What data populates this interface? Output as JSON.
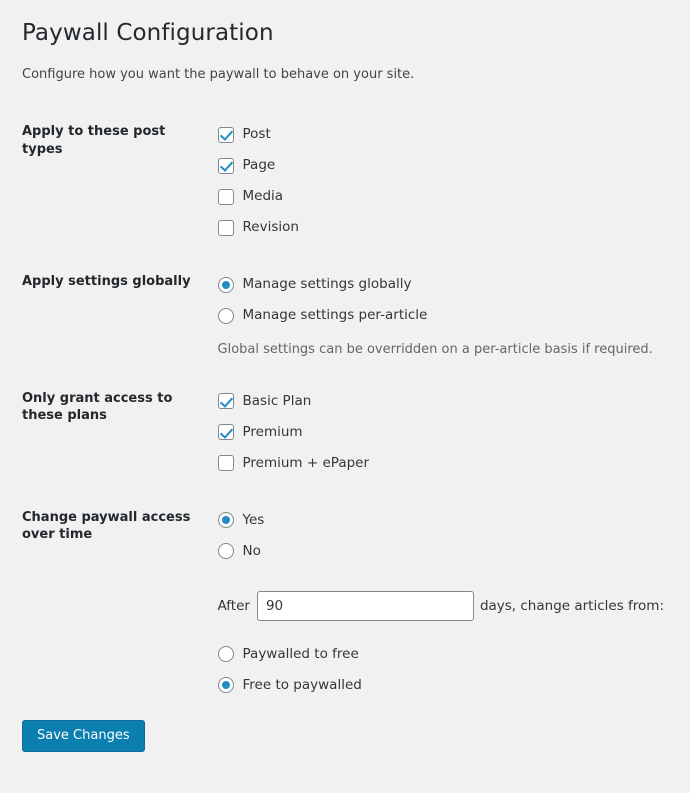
{
  "page": {
    "title": "Paywall Configuration",
    "subtitle": "Configure how you want the paywall to behave on your site."
  },
  "colors": {
    "background": "#f1f1f1",
    "accent": "#1f8dc4",
    "button": "#0b7fb0",
    "text": "#32373c",
    "muted": "#666666"
  },
  "sections": {
    "post_types": {
      "label": "Apply to these post types",
      "options": [
        {
          "label": "Post",
          "checked": true
        },
        {
          "label": "Page",
          "checked": true
        },
        {
          "label": "Media",
          "checked": false
        },
        {
          "label": "Revision",
          "checked": false
        }
      ]
    },
    "global_settings": {
      "label": "Apply settings globally",
      "options": [
        {
          "label": "Manage settings globally",
          "checked": true
        },
        {
          "label": "Manage settings per-article",
          "checked": false
        }
      ],
      "helper": "Global settings can be overridden on a per-article basis if required."
    },
    "plans": {
      "label": "Only grant access to these plans",
      "options": [
        {
          "label": "Basic Plan",
          "checked": true
        },
        {
          "label": "Premium",
          "checked": true
        },
        {
          "label": "Premium + ePaper",
          "checked": false
        }
      ]
    },
    "access_over_time": {
      "label": "Change paywall access over time",
      "options": [
        {
          "label": "Yes",
          "checked": true
        },
        {
          "label": "No",
          "checked": false
        }
      ],
      "duration": {
        "prefix": "After",
        "value": "90",
        "placeholder": "",
        "suffix": "days, change articles from:"
      },
      "direction_options": [
        {
          "label": "Paywalled to free",
          "checked": false
        },
        {
          "label": "Free to paywalled",
          "checked": true
        }
      ]
    }
  },
  "submit": {
    "save_label": "Save Changes"
  }
}
